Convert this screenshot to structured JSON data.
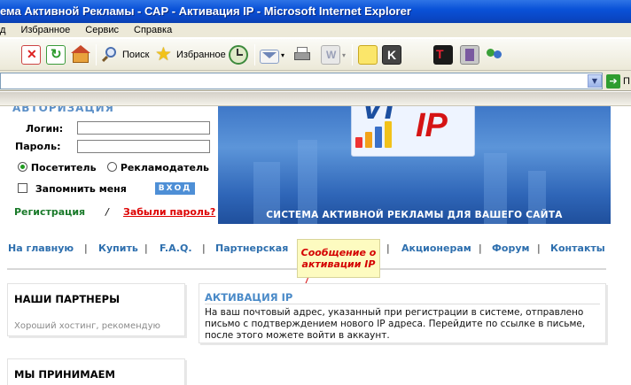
{
  "window": {
    "title": "ема Активной Рекламы - САР - Активация IP - Microsoft Internet Explorer"
  },
  "menu": {
    "items": [
      "д",
      "Избранное",
      "Сервис",
      "Справка"
    ]
  },
  "toolbar": {
    "search_label": "Поиск",
    "favorites_label": "Избранное"
  },
  "address": {
    "value": "",
    "go_label": "П"
  },
  "login": {
    "title": "АВТОРИЗАЦИЯ",
    "login_label": "Логин:",
    "password_label": "Пароль:",
    "visitor_label": "Посетитель",
    "advertiser_label": "Рекламодатель",
    "remember_label": "Запомнить меня",
    "enter_label": "ВХОД",
    "register_label": "Регистрация",
    "slash": "/",
    "forgot_label": "Забыли пароль?"
  },
  "banner": {
    "logo_left": "VI",
    "logo_right": "IP",
    "tagline": "СИСТЕМА АКТИВНОЙ РЕКЛАМЫ ДЛЯ ВАШЕГО САЙТА"
  },
  "nav": {
    "items": [
      "На главную",
      "Купить",
      "F.A.Q.",
      "Партнерская",
      "Акционерам",
      "Форум",
      "Контакты"
    ],
    "separator": "|"
  },
  "callout": {
    "text": "Сообщение о активации IP"
  },
  "partners": {
    "title": "НАШИ ПАРТНЕРЫ",
    "subtitle": "Хороший хостинг, рекомендую"
  },
  "accept": {
    "title": "МЫ ПРИНИМАЕМ"
  },
  "activation": {
    "title": "АКТИВАЦИЯ IP",
    "body": "На ваш почтовый адрес, указанный при регистрации в системе, отправлено письмо с подтверждением нового IP адреса. Перейдите по ссылке в письме, после этого можете войти в аккаунт."
  },
  "colors": {
    "title_blue": "#0a52d8",
    "link_blue": "#2e6fae",
    "accent_red": "#d40000",
    "reg_green": "#1a7a2a"
  }
}
